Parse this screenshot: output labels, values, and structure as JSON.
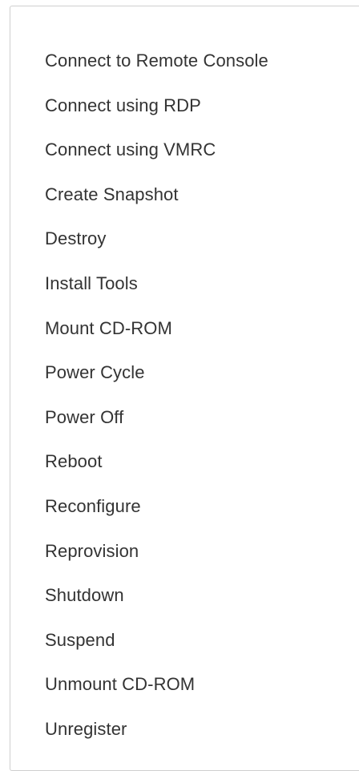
{
  "menu": {
    "items": [
      {
        "label": "Connect to Remote Console"
      },
      {
        "label": "Connect using RDP"
      },
      {
        "label": "Connect using VMRC"
      },
      {
        "label": "Create Snapshot"
      },
      {
        "label": "Destroy"
      },
      {
        "label": "Install Tools"
      },
      {
        "label": "Mount CD-ROM"
      },
      {
        "label": "Power Cycle"
      },
      {
        "label": "Power Off"
      },
      {
        "label": "Reboot"
      },
      {
        "label": "Reconfigure"
      },
      {
        "label": "Reprovision"
      },
      {
        "label": "Shutdown"
      },
      {
        "label": "Suspend"
      },
      {
        "label": "Unmount CD-ROM"
      },
      {
        "label": "Unregister"
      }
    ]
  },
  "colors": {
    "text": "#333333",
    "border": "#cfcfcf",
    "background": "#ffffff"
  }
}
